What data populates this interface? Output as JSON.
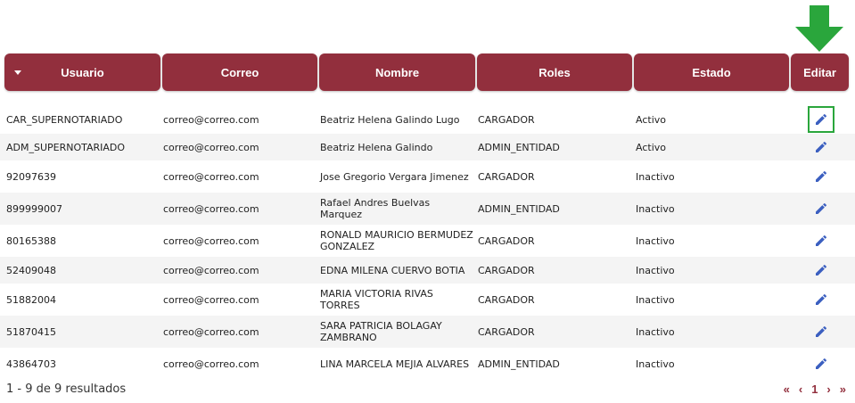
{
  "colors": {
    "header_bg": "#922f3d",
    "edit_icon": "#3b5fc0",
    "highlight": "#2aa63c",
    "arrow": "#2aa63c"
  },
  "table": {
    "columns": [
      "Usuario",
      "Correo",
      "Nombre",
      "Roles",
      "Estado",
      "Editar"
    ],
    "rows": [
      {
        "usuario": "CAR_SUPERNOTARIADO",
        "correo": "correo@correo.com",
        "nombre": "Beatriz Helena Galindo Lugo",
        "roles": "CARGADOR",
        "estado": "Activo"
      },
      {
        "usuario": "ADM_SUPERNOTARIADO",
        "correo": "correo@correo.com",
        "nombre": "Beatriz Helena Galindo",
        "roles": "ADMIN_ENTIDAD",
        "estado": "Activo"
      },
      {
        "usuario": "92097639",
        "correo": "correo@correo.com",
        "nombre": "Jose Gregorio Vergara Jimenez",
        "roles": "CARGADOR",
        "estado": "Inactivo"
      },
      {
        "usuario": "899999007",
        "correo": "correo@correo.com",
        "nombre": "Rafael Andres Buelvas Marquez",
        "roles": "ADMIN_ENTIDAD",
        "estado": "Inactivo"
      },
      {
        "usuario": "80165388",
        "correo": "correo@correo.com",
        "nombre": "RONALD MAURICIO BERMUDEZ GONZALEZ",
        "roles": "CARGADOR",
        "estado": "Inactivo"
      },
      {
        "usuario": "52409048",
        "correo": "correo@correo.com",
        "nombre": "EDNA MILENA CUERVO BOTIA",
        "roles": "CARGADOR",
        "estado": "Inactivo"
      },
      {
        "usuario": "51882004",
        "correo": "correo@correo.com",
        "nombre": "MARIA VICTORIA RIVAS TORRES",
        "roles": "CARGADOR",
        "estado": "Inactivo"
      },
      {
        "usuario": "51870415",
        "correo": "correo@correo.com",
        "nombre": "SARA PATRICIA BOLAGAY ZAMBRANO",
        "roles": "CARGADOR",
        "estado": "Inactivo"
      },
      {
        "usuario": "43864703",
        "correo": "correo@correo.com",
        "nombre": "LINA MARCELA MEJIA ALVARES",
        "roles": "ADMIN_ENTIDAD",
        "estado": "Inactivo"
      }
    ],
    "highlighted_row": 0
  },
  "footer": {
    "results_text": "1 - 9 de 9 resultados",
    "pager": {
      "first": "«",
      "prev": "‹",
      "page": "1",
      "next": "›",
      "last": "»"
    }
  },
  "icons": {
    "sort": "caret-down-icon",
    "edit": "pencil-icon",
    "annotation": "arrow-down-icon"
  }
}
